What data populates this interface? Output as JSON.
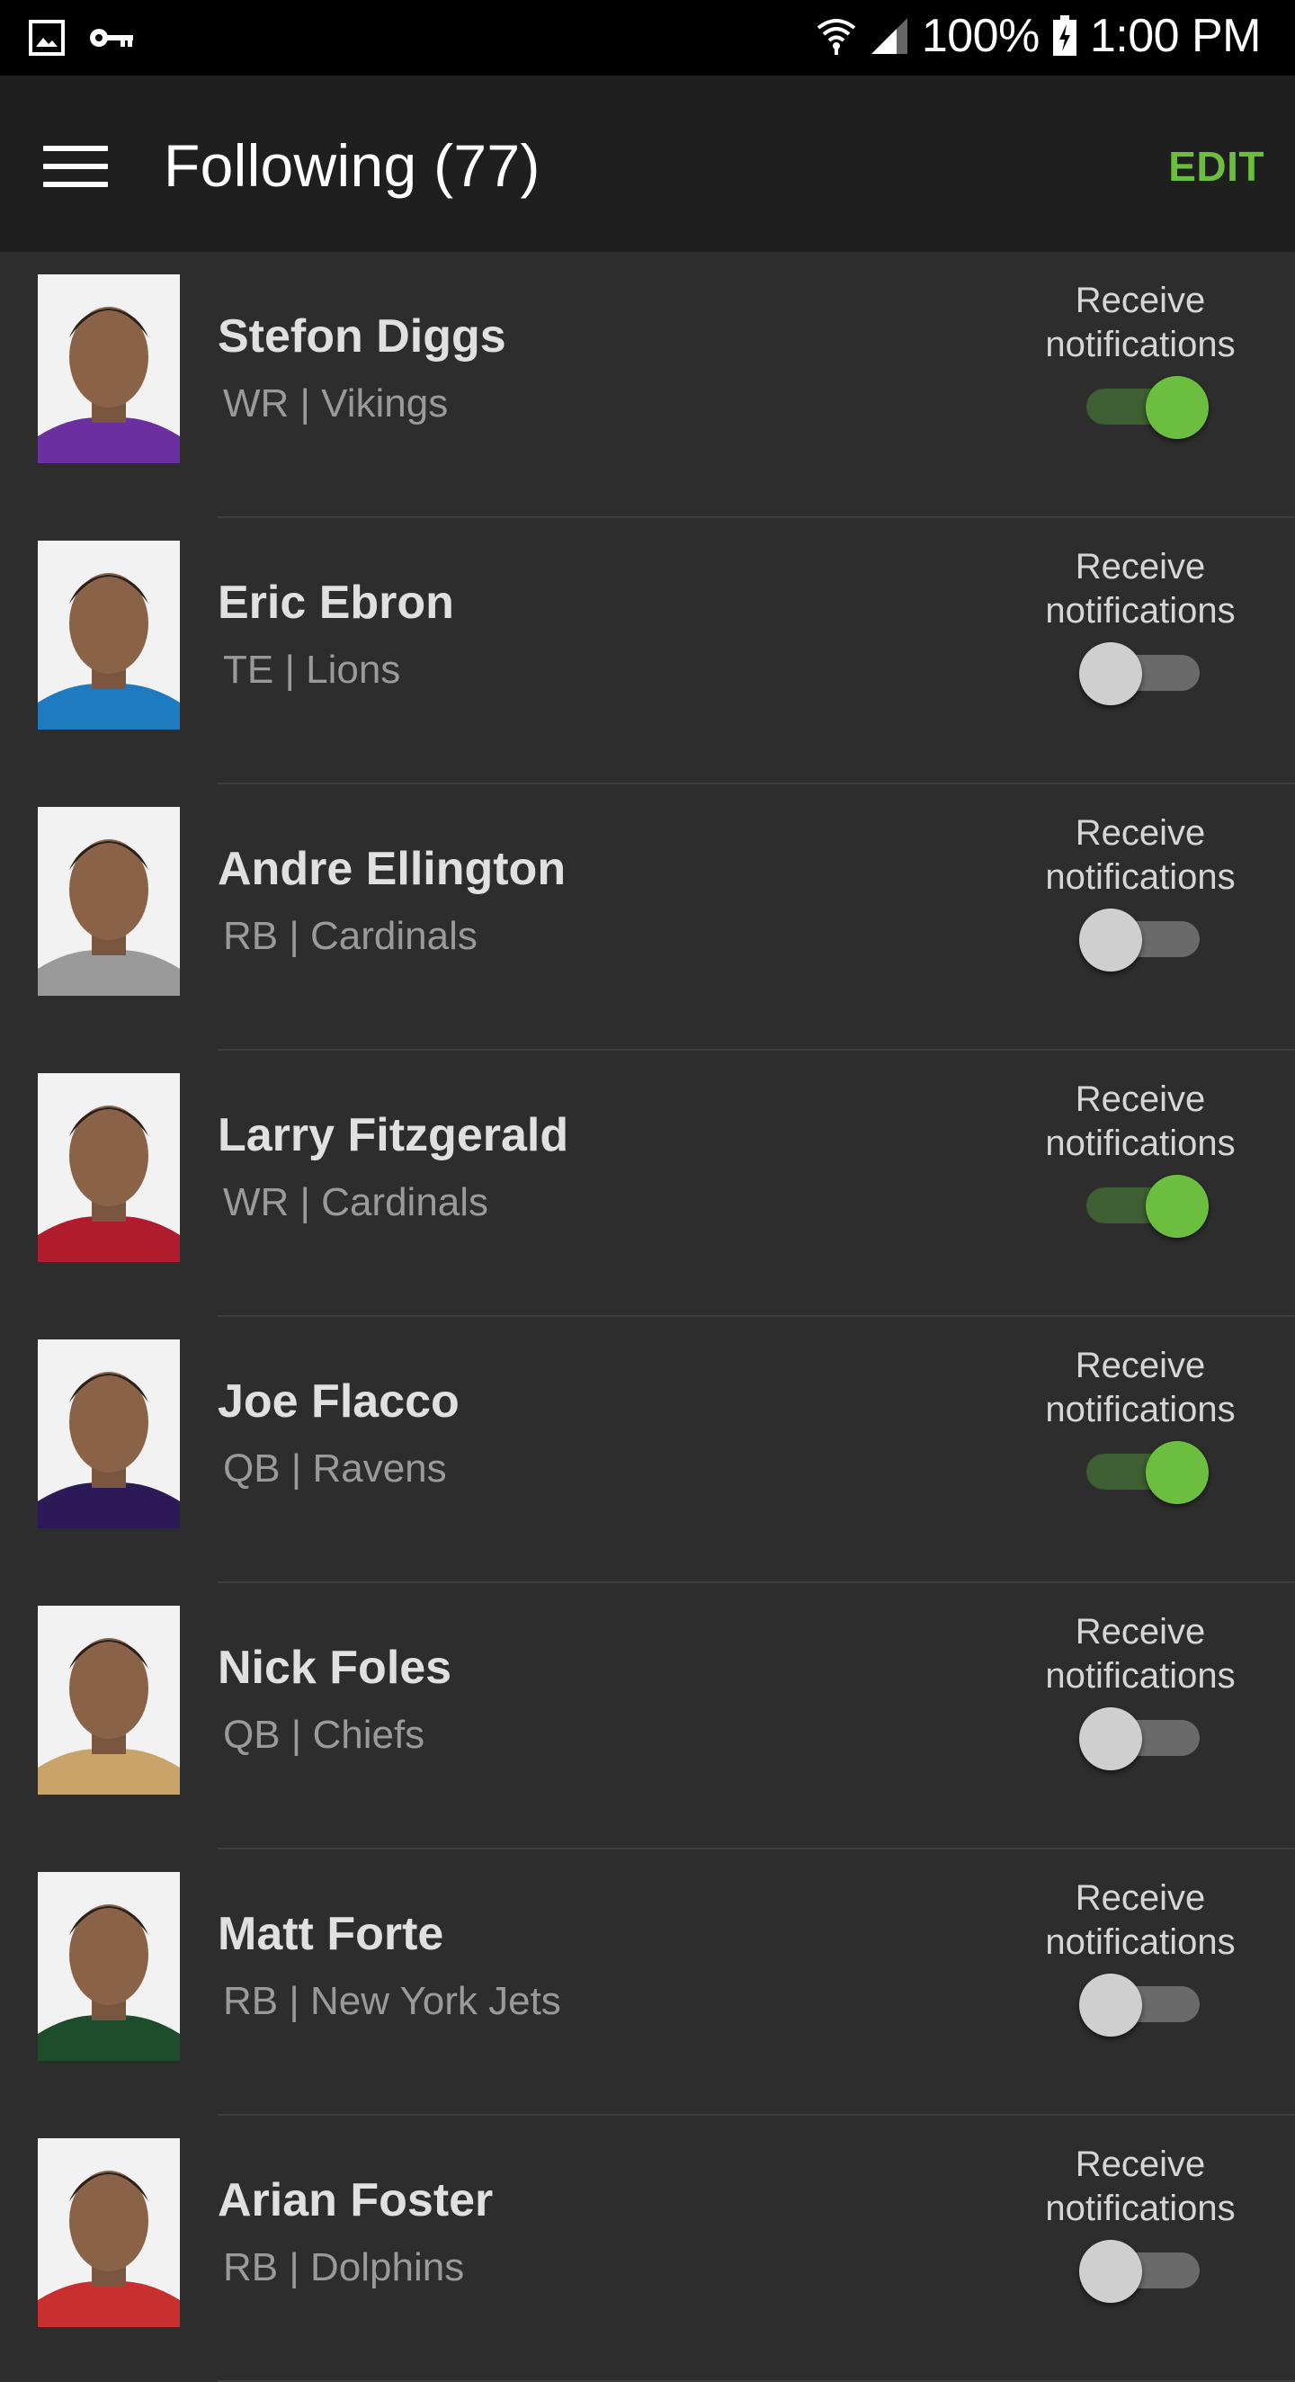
{
  "status_bar": {
    "battery": "100%",
    "time": "1:00 PM",
    "icons": [
      "image-icon",
      "key-icon",
      "wifi-icon",
      "signal-icon",
      "battery-charging-icon"
    ]
  },
  "app_bar": {
    "title": "Following (77)",
    "edit_label": "EDIT",
    "accent_color": "#6cbe3f"
  },
  "notif_label_line1": "Receive",
  "notif_label_line2": "notifications",
  "players": [
    {
      "name": "Stefon Diggs",
      "position_team": "WR | Vikings",
      "notifications_on": true,
      "jersey_color": "#6b2fa0"
    },
    {
      "name": "Eric Ebron",
      "position_team": "TE | Lions",
      "notifications_on": false,
      "jersey_color": "#1e7bbf"
    },
    {
      "name": "Andre Ellington",
      "position_team": "RB | Cardinals",
      "notifications_on": false,
      "jersey_color": "#9a9a9a"
    },
    {
      "name": "Larry Fitzgerald",
      "position_team": "WR | Cardinals",
      "notifications_on": true,
      "jersey_color": "#b01c2e"
    },
    {
      "name": "Joe Flacco",
      "position_team": "QB | Ravens",
      "notifications_on": true,
      "jersey_color": "#2b1a57"
    },
    {
      "name": "Nick Foles",
      "position_team": "QB | Chiefs",
      "notifications_on": false,
      "jersey_color": "#c9a36a"
    },
    {
      "name": "Matt Forte",
      "position_team": "RB | New York Jets",
      "notifications_on": false,
      "jersey_color": "#1e4d2b"
    },
    {
      "name": "Arian Foster",
      "position_team": "RB | Dolphins",
      "notifications_on": false,
      "jersey_color": "#c83030"
    }
  ]
}
